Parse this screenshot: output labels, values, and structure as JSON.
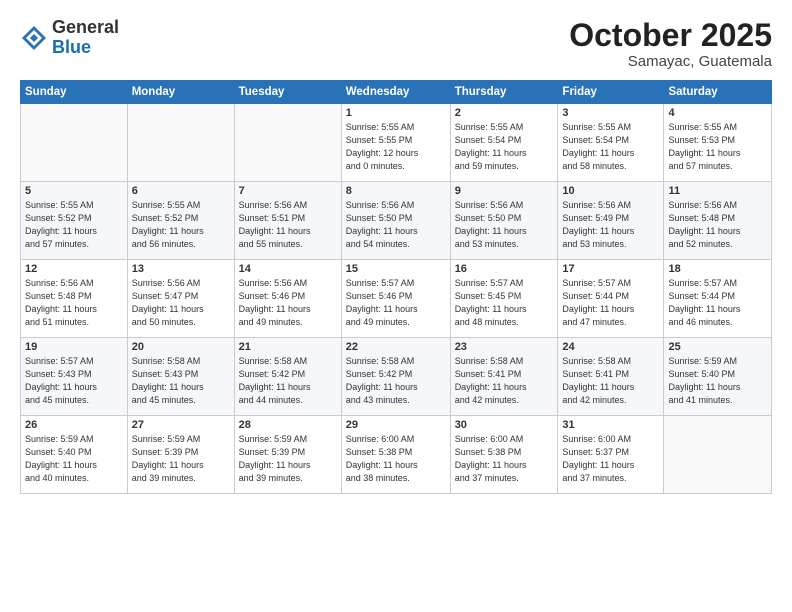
{
  "header": {
    "logo_general": "General",
    "logo_blue": "Blue",
    "month_title": "October 2025",
    "location": "Samayac, Guatemala"
  },
  "weekdays": [
    "Sunday",
    "Monday",
    "Tuesday",
    "Wednesday",
    "Thursday",
    "Friday",
    "Saturday"
  ],
  "weeks": [
    [
      {
        "day": "",
        "info": ""
      },
      {
        "day": "",
        "info": ""
      },
      {
        "day": "",
        "info": ""
      },
      {
        "day": "1",
        "info": "Sunrise: 5:55 AM\nSunset: 5:55 PM\nDaylight: 12 hours\nand 0 minutes."
      },
      {
        "day": "2",
        "info": "Sunrise: 5:55 AM\nSunset: 5:54 PM\nDaylight: 11 hours\nand 59 minutes."
      },
      {
        "day": "3",
        "info": "Sunrise: 5:55 AM\nSunset: 5:54 PM\nDaylight: 11 hours\nand 58 minutes."
      },
      {
        "day": "4",
        "info": "Sunrise: 5:55 AM\nSunset: 5:53 PM\nDaylight: 11 hours\nand 57 minutes."
      }
    ],
    [
      {
        "day": "5",
        "info": "Sunrise: 5:55 AM\nSunset: 5:52 PM\nDaylight: 11 hours\nand 57 minutes."
      },
      {
        "day": "6",
        "info": "Sunrise: 5:55 AM\nSunset: 5:52 PM\nDaylight: 11 hours\nand 56 minutes."
      },
      {
        "day": "7",
        "info": "Sunrise: 5:56 AM\nSunset: 5:51 PM\nDaylight: 11 hours\nand 55 minutes."
      },
      {
        "day": "8",
        "info": "Sunrise: 5:56 AM\nSunset: 5:50 PM\nDaylight: 11 hours\nand 54 minutes."
      },
      {
        "day": "9",
        "info": "Sunrise: 5:56 AM\nSunset: 5:50 PM\nDaylight: 11 hours\nand 53 minutes."
      },
      {
        "day": "10",
        "info": "Sunrise: 5:56 AM\nSunset: 5:49 PM\nDaylight: 11 hours\nand 53 minutes."
      },
      {
        "day": "11",
        "info": "Sunrise: 5:56 AM\nSunset: 5:48 PM\nDaylight: 11 hours\nand 52 minutes."
      }
    ],
    [
      {
        "day": "12",
        "info": "Sunrise: 5:56 AM\nSunset: 5:48 PM\nDaylight: 11 hours\nand 51 minutes."
      },
      {
        "day": "13",
        "info": "Sunrise: 5:56 AM\nSunset: 5:47 PM\nDaylight: 11 hours\nand 50 minutes."
      },
      {
        "day": "14",
        "info": "Sunrise: 5:56 AM\nSunset: 5:46 PM\nDaylight: 11 hours\nand 49 minutes."
      },
      {
        "day": "15",
        "info": "Sunrise: 5:57 AM\nSunset: 5:46 PM\nDaylight: 11 hours\nand 49 minutes."
      },
      {
        "day": "16",
        "info": "Sunrise: 5:57 AM\nSunset: 5:45 PM\nDaylight: 11 hours\nand 48 minutes."
      },
      {
        "day": "17",
        "info": "Sunrise: 5:57 AM\nSunset: 5:44 PM\nDaylight: 11 hours\nand 47 minutes."
      },
      {
        "day": "18",
        "info": "Sunrise: 5:57 AM\nSunset: 5:44 PM\nDaylight: 11 hours\nand 46 minutes."
      }
    ],
    [
      {
        "day": "19",
        "info": "Sunrise: 5:57 AM\nSunset: 5:43 PM\nDaylight: 11 hours\nand 45 minutes."
      },
      {
        "day": "20",
        "info": "Sunrise: 5:58 AM\nSunset: 5:43 PM\nDaylight: 11 hours\nand 45 minutes."
      },
      {
        "day": "21",
        "info": "Sunrise: 5:58 AM\nSunset: 5:42 PM\nDaylight: 11 hours\nand 44 minutes."
      },
      {
        "day": "22",
        "info": "Sunrise: 5:58 AM\nSunset: 5:42 PM\nDaylight: 11 hours\nand 43 minutes."
      },
      {
        "day": "23",
        "info": "Sunrise: 5:58 AM\nSunset: 5:41 PM\nDaylight: 11 hours\nand 42 minutes."
      },
      {
        "day": "24",
        "info": "Sunrise: 5:58 AM\nSunset: 5:41 PM\nDaylight: 11 hours\nand 42 minutes."
      },
      {
        "day": "25",
        "info": "Sunrise: 5:59 AM\nSunset: 5:40 PM\nDaylight: 11 hours\nand 41 minutes."
      }
    ],
    [
      {
        "day": "26",
        "info": "Sunrise: 5:59 AM\nSunset: 5:40 PM\nDaylight: 11 hours\nand 40 minutes."
      },
      {
        "day": "27",
        "info": "Sunrise: 5:59 AM\nSunset: 5:39 PM\nDaylight: 11 hours\nand 39 minutes."
      },
      {
        "day": "28",
        "info": "Sunrise: 5:59 AM\nSunset: 5:39 PM\nDaylight: 11 hours\nand 39 minutes."
      },
      {
        "day": "29",
        "info": "Sunrise: 6:00 AM\nSunset: 5:38 PM\nDaylight: 11 hours\nand 38 minutes."
      },
      {
        "day": "30",
        "info": "Sunrise: 6:00 AM\nSunset: 5:38 PM\nDaylight: 11 hours\nand 37 minutes."
      },
      {
        "day": "31",
        "info": "Sunrise: 6:00 AM\nSunset: 5:37 PM\nDaylight: 11 hours\nand 37 minutes."
      },
      {
        "day": "",
        "info": ""
      }
    ]
  ]
}
